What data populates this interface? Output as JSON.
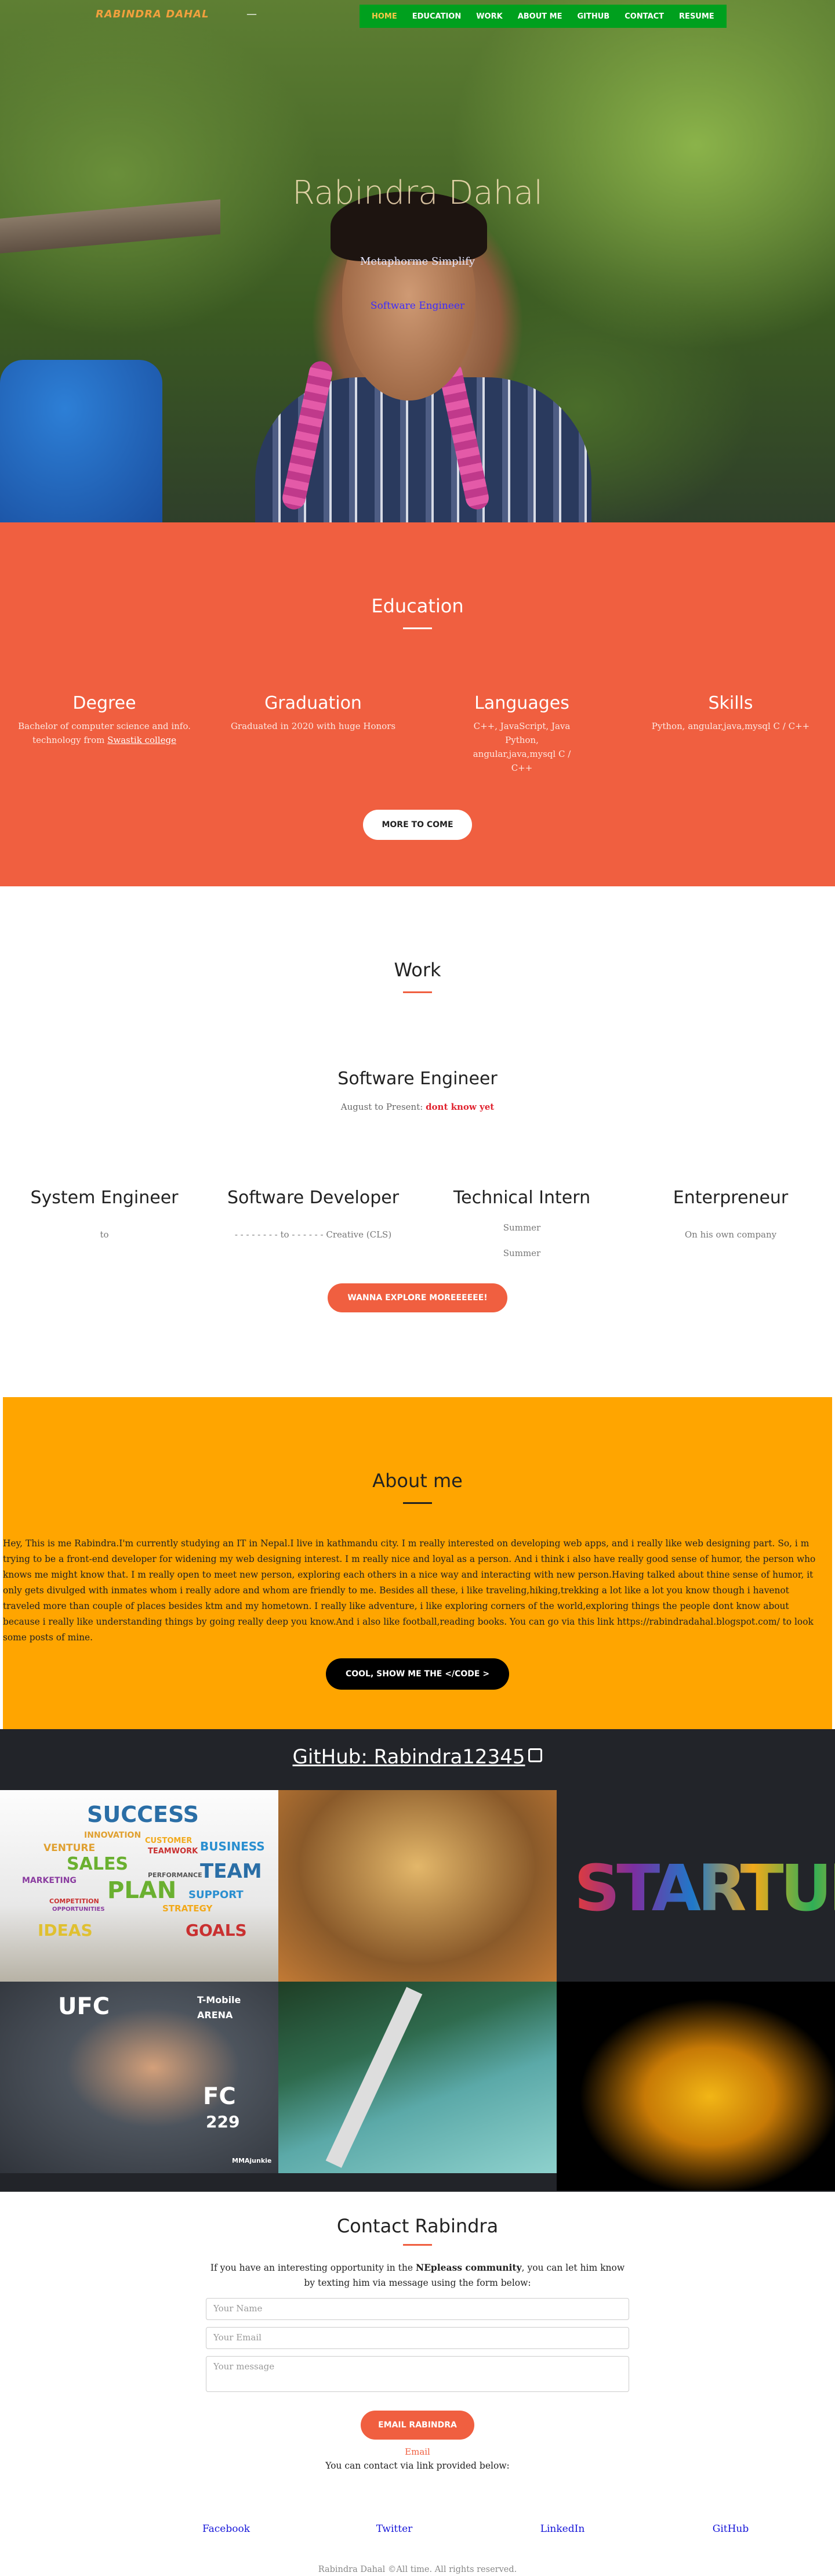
{
  "nav": {
    "brand": "RABINDRA DAHAL",
    "separator": "—",
    "items": [
      {
        "label": "HOME",
        "active": true
      },
      {
        "label": "EDUCATION"
      },
      {
        "label": "WORK"
      },
      {
        "label": "ABOUT ME"
      },
      {
        "label": "GITHUB"
      },
      {
        "label": "CONTACT"
      },
      {
        "label": "RESUME"
      }
    ]
  },
  "hero": {
    "title": "Rabindra Dahal",
    "subtitle": "Metaphorme Simplify",
    "role": "Software Engineer"
  },
  "education": {
    "title": "Education",
    "columns": [
      {
        "heading": "Degree",
        "text": "Bachelor of computer science and info. technology from ",
        "link": "Swastik college"
      },
      {
        "heading": "Graduation",
        "text": "Graduated in 2020 with huge Honors"
      },
      {
        "heading": "Languages",
        "text": "C++, JavaScript, Java Python, angular,java,mysql C / C++"
      },
      {
        "heading": "Skills",
        "text": "Python, angular,java,mysql C / C++"
      }
    ],
    "button": "MORE TO COME"
  },
  "work": {
    "title": "Work",
    "main_role": "Software Engineer",
    "main_date_prefix": "August to Present: ",
    "main_date_highlight": "dont know yet",
    "columns": [
      {
        "heading": "System Engineer",
        "lines": [
          "to"
        ]
      },
      {
        "heading": "Software Developer",
        "lines": [
          "- - - - - - - - to - - - - - - Creative (CLS)"
        ]
      },
      {
        "heading": "Technical Intern",
        "lines": [
          "Summer",
          "Summer"
        ]
      },
      {
        "heading": "Enterpreneur",
        "lines": [
          "On his own company"
        ]
      }
    ],
    "button": "WANNA EXPLORE MOREEEEEE!"
  },
  "about": {
    "title": "About me",
    "text": "Hey, This is me Rabindra.I'm currently studying an IT in Nepal.I live in kathmandu city. I m really interested on developing web apps, and i really like web designing part. So, i m trying to be a front-end developer for widening my web designing interest. I m really nice and loyal as a person. And i think i also have really good sense of humor, the person who knows me might know that. I m really open to meet new person, exploring each others in a nice way and interacting with new person.Having talked about thine sense of humor, it only gets divulged with inmates whom i really adore and whom are friendly to me. Besides all these, i like traveling,hiking,trekking a lot like a lot you know though i havenot traveled more than couple of places besides ktm and my hometown. I really like adventure, i like exploring corners of the world,exploring things the people dont know about because i really like understanding things by going really deep you know.And i also like football,reading books. You can go via this link https://rabindradahal.blogspot.com/ to look some posts of mine.",
    "button": "COOL, SHOW ME THE </CODE >"
  },
  "github": {
    "title": "GitHub: Rabindra12345",
    "tile1_words": [
      "SUCCESS",
      "INNOVATION",
      "CUSTOMER",
      "BUSINESS",
      "VENTURE",
      "TEAMWORK",
      "SALES",
      "TEAM",
      "MARKETING",
      "PLAN",
      "PERFORMANCE",
      "SUPPORT",
      "COMPETITION",
      "STRATEGY",
      "OPPORTUNITIES",
      "IDEAS",
      "GOALS"
    ],
    "tile3_word": "STARTUP",
    "tile4_texts": [
      "UFC",
      "T-Mobile",
      "ARENA",
      "FC",
      "229",
      "MMAjunkie"
    ]
  },
  "contact": {
    "title": "Contact Rabindra",
    "intro_start": "If you have an interesting opportunity in the ",
    "intro_bold": "NEpleass community",
    "intro_end": ", you can let him know by texting him via message using the form below:",
    "name_placeholder": "Your Name",
    "email_placeholder": "Your Email",
    "message_placeholder": "Your message",
    "button": "EMAIL RABINDRA",
    "email_label": "Email",
    "links_intro": "You can contact via link provided below:",
    "links": [
      "Facebook",
      "Twitter",
      "LinkedIn",
      "GitHub"
    ],
    "footer": "Rabindra Dahal ©All time. All rights reserved."
  },
  "colors": {
    "accent": "#f05f40",
    "about_bg": "#ffa500",
    "nav_bg": "#00a01e",
    "github_bg": "#222429"
  }
}
